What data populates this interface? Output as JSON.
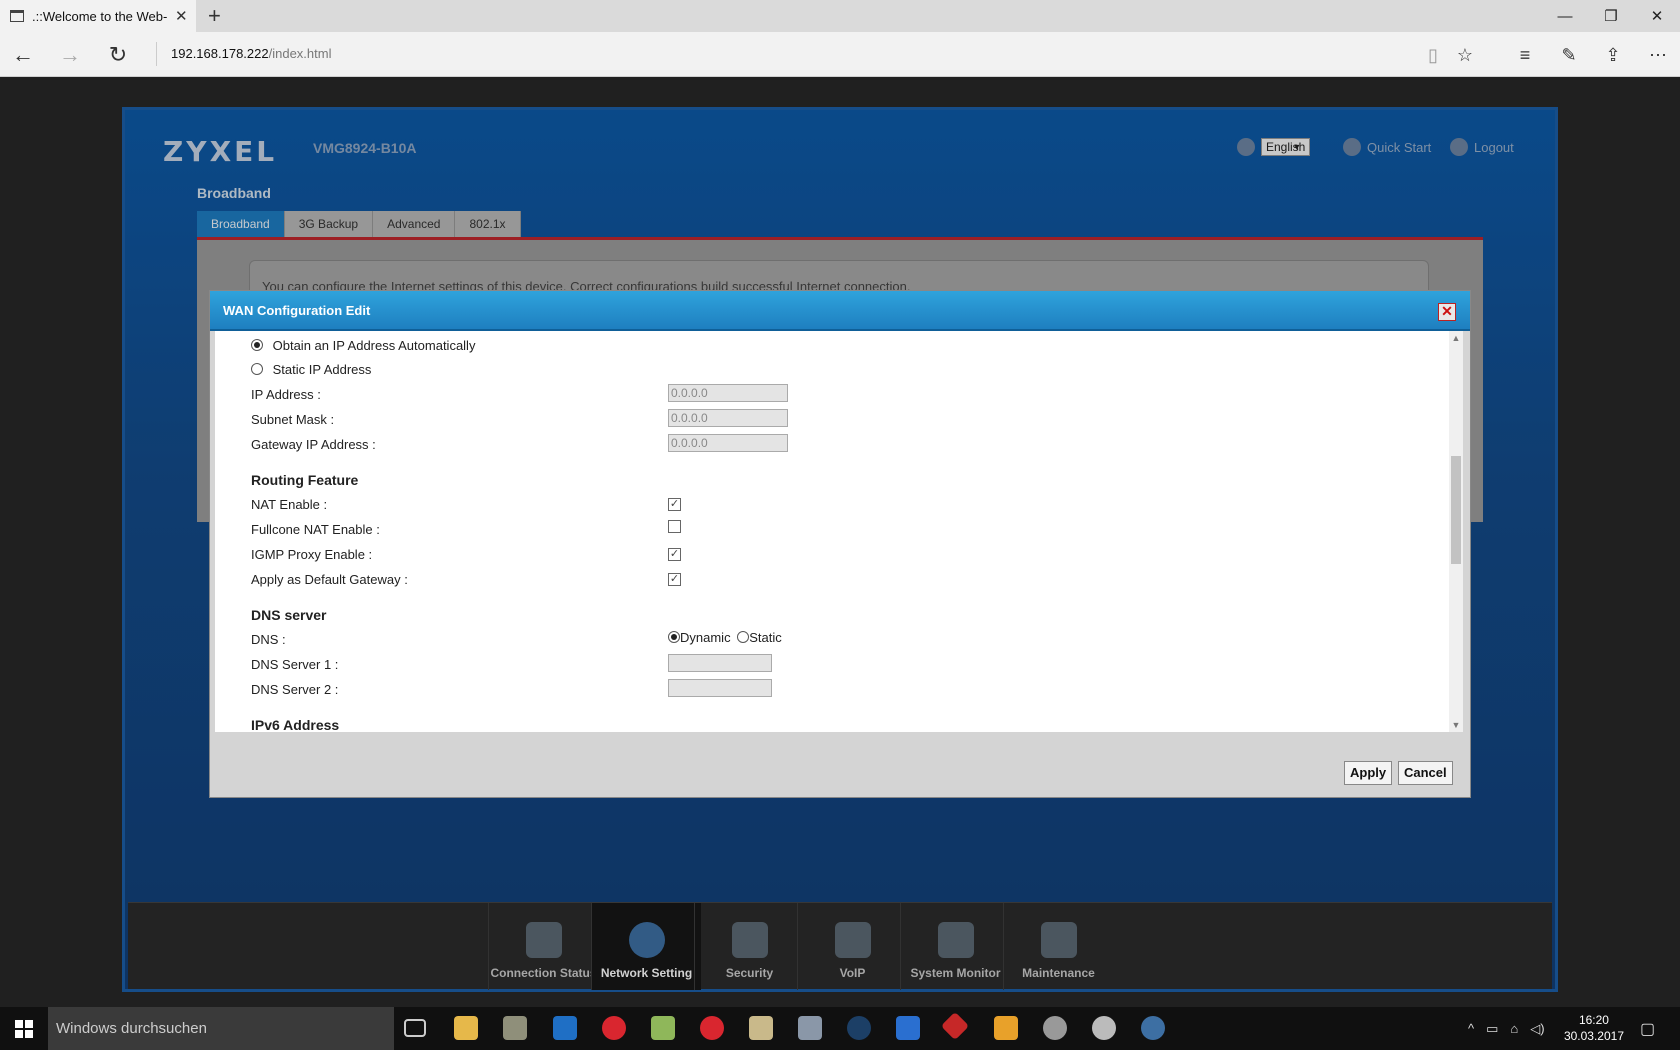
{
  "browser": {
    "tab_title": ".::Welcome to the Web-",
    "tab_close": "✕",
    "new_tab": "+",
    "url_host": "192.168.178.222",
    "url_path": "/index.html",
    "window_controls": [
      "—",
      "❐",
      "✕"
    ]
  },
  "router": {
    "logo": "ZYXEL",
    "model": "VMG8924-B10A",
    "language": "English",
    "quick_start": "Quick Start",
    "logout": "Logout",
    "breadcrumb": "Broadband",
    "tabs": [
      "Broadband",
      "3G Backup",
      "Advanced",
      "802.1x"
    ],
    "active_tab": 0,
    "note": "You can configure the Internet settings of this device. Correct configurations build successful Internet connection.",
    "bottom_nav": [
      "Connection Status",
      "Network Setting",
      "Security",
      "VoIP",
      "System Monitor",
      "Maintenance"
    ],
    "bottom_nav_active": 1
  },
  "modal": {
    "title": "WAN Configuration Edit",
    "close": "✕",
    "ip_mode": {
      "auto_label": "Obtain an IP Address Automatically",
      "static_label": "Static IP Address",
      "selected": "auto"
    },
    "ip_address_label": "IP Address :",
    "ip_address_value": "0.0.0.0",
    "subnet_label": "Subnet Mask :",
    "subnet_value": "0.0.0.0",
    "gateway_label": "Gateway IP Address :",
    "gateway_value": "0.0.0.0",
    "routing_title": "Routing Feature",
    "nat_label": "NAT Enable :",
    "nat_checked": true,
    "fullcone_label": "Fullcone NAT Enable :",
    "fullcone_checked": false,
    "igmp_label": "IGMP Proxy Enable :",
    "igmp_checked": true,
    "default_gw_label": "Apply as Default Gateway :",
    "default_gw_checked": true,
    "dns_title": "DNS server",
    "dns_label": "DNS :",
    "dns_dynamic": "Dynamic",
    "dns_static": "Static",
    "dns_selected": "dynamic",
    "dns1_label": "DNS Server 1 :",
    "dns2_label": "DNS Server 2 :",
    "ipv6_title": "IPv6 Address",
    "apply": "Apply",
    "cancel": "Cancel"
  },
  "taskbar": {
    "search_placeholder": "Windows durchsuchen",
    "time": "16:20",
    "date": "30.03.2017"
  }
}
